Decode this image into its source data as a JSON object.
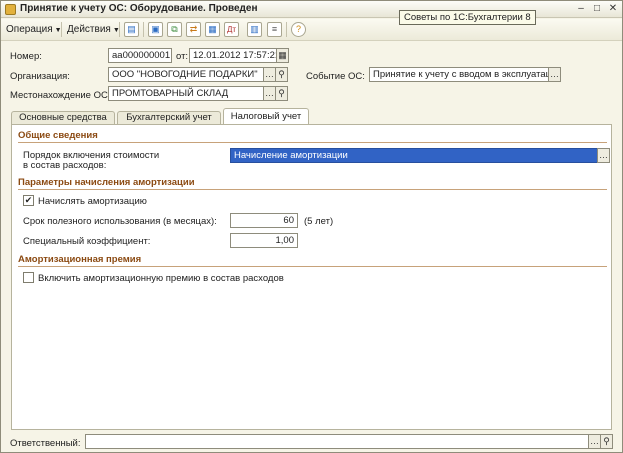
{
  "window": {
    "title": "Принятие к учету ОС: Оборудование. Проведен",
    "tooltip": "Советы по 1С:Бухгалтерии 8"
  },
  "toolbar": {
    "menu_operation": "Операция",
    "menu_actions": "Действия"
  },
  "header": {
    "number_label": "Номер:",
    "number_value": "аа000000001",
    "date_label": "от:",
    "date_value": "12.01.2012 17:57:21",
    "organization_label": "Организация:",
    "organization_value": "ООО \"НОВОГОДНИЕ ПОДАРКИ\"",
    "event_label": "Событие ОС:",
    "event_value": "Принятие к учету с вводом в эксплуатац",
    "location_label": "Местонахождение ОС:",
    "location_value": "ПРОМТОВАРНЫЙ СКЛАД"
  },
  "tabs": [
    {
      "label": "Основные средства",
      "active": false
    },
    {
      "label": "Бухгалтерский учет",
      "active": false
    },
    {
      "label": "Налоговый учет",
      "active": true
    }
  ],
  "tax": {
    "general_title": "Общие сведения",
    "expense_order_label_line1": "Порядок включения стоимости",
    "expense_order_label_line2": "в состав расходов:",
    "expense_order_value": "Начисление амортизации",
    "depr_params_title": "Параметры начисления амортизации",
    "accrue_depr_label": "Начислять амортизацию",
    "accrue_depr_checked": true,
    "useful_life_label": "Срок полезного использования (в месяцах):",
    "useful_life_value": "60",
    "useful_life_years": "(5 лет)",
    "special_coef_label": "Специальный коэффициент:",
    "special_coef_value": "1,00",
    "bonus_title": "Амортизационная премия",
    "bonus_label": "Включить амортизационную премию в состав расходов",
    "bonus_checked": false
  },
  "footer": {
    "responsible_label": "Ответственный:",
    "responsible_value": ""
  },
  "colors": {
    "section_title": "#8b4a12",
    "selection": "#3163c5"
  }
}
